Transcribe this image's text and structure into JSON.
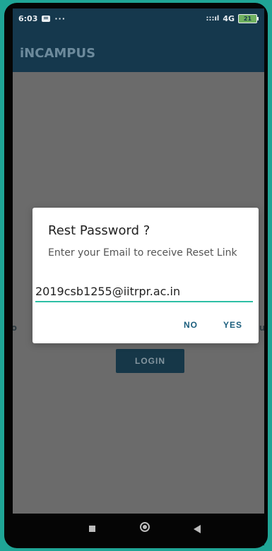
{
  "status": {
    "time": "6:03",
    "notif_dots": "···",
    "signal": ":::ıl",
    "network": "4G",
    "battery": "21"
  },
  "app": {
    "title": "iNCAMPUS"
  },
  "background": {
    "forgot_fragment": "Fo",
    "signup_fragment": "up",
    "login_label": "LOGIN"
  },
  "dialog": {
    "title": "Rest Password ?",
    "message": "Enter your Email to receive Reset Link",
    "email_value": "2019csb1255@iitrpr.ac.in",
    "no_label": "NO",
    "yes_label": "YES"
  },
  "nav": {
    "icons": [
      "square-icon",
      "circle-icon",
      "back-icon"
    ]
  }
}
